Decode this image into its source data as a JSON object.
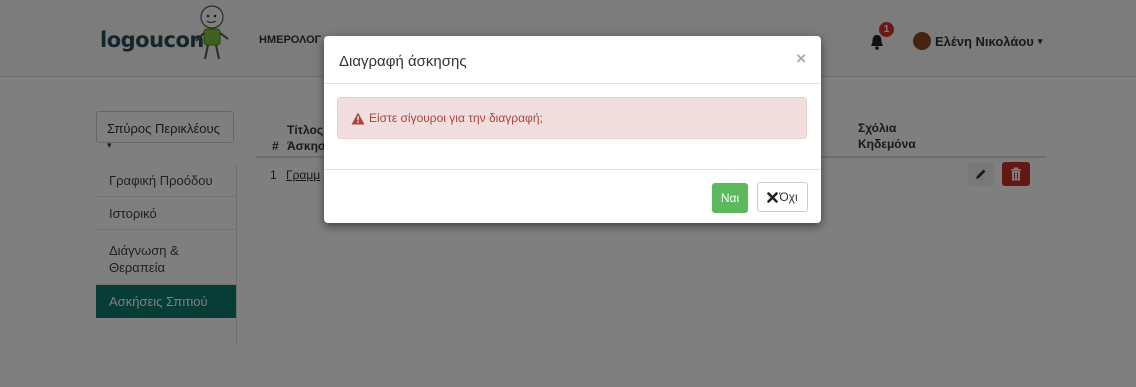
{
  "navbar": {
    "logo_text": "logoucon",
    "nav_link": "ΗΜΕΡΟΛΟΓ",
    "notification_count": "1",
    "user_name": "Ελένη Νικολάου"
  },
  "sidebar": {
    "student_dropdown": "Σπύρος Περικλέους",
    "items": [
      {
        "label": "Γραφική Προόδου"
      },
      {
        "label": "Ιστορικό"
      },
      {
        "label": "Διάγνωση & Θεραπεία"
      },
      {
        "label": "Ασκήσεις Σπιτιού"
      }
    ]
  },
  "table": {
    "headers": {
      "number": "#",
      "title_line1": "Τίτλος",
      "title_line2": "Άσκησ",
      "comments_line1": "Σχόλια",
      "comments_line2": "Κηδεμόνα"
    },
    "rows": [
      {
        "num": "1",
        "title": "Γραμμ"
      }
    ]
  },
  "modal": {
    "title": "Διαγραφή άσκησης",
    "close_symbol": "×",
    "alert_text": "Είστε σίγουροι για την διαγραφή;",
    "yes_label": "Ναι",
    "no_label": "Όχι"
  },
  "colors": {
    "active_sidebar": "#10796f",
    "danger": "#c9302c",
    "success": "#5cb85c",
    "alert_bg": "#f2dede"
  }
}
